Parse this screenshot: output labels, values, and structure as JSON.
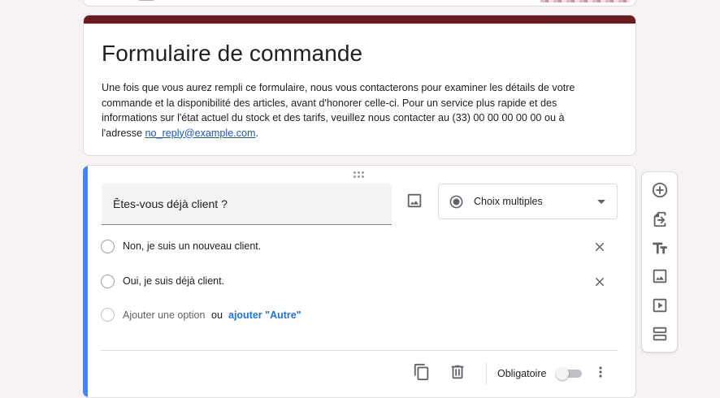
{
  "form": {
    "title": "Formulaire de commande",
    "description_before_link": "Une fois que vous aurez rempli ce formulaire, nous vous contacterons pour examiner les détails de votre commande et la disponibilité des articles, avant d'honorer celle-ci. Pour un service plus rapide et des informations sur l'état actuel du stock et des tarifs, veuillez nous contacter au (33) 00 00 00 00 00 ou à l'adresse ",
    "description_link": "no_reply@example.com",
    "description_after_link": ".",
    "accent_color": "#6b1a1d"
  },
  "question": {
    "title": "Êtes-vous déjà client ?",
    "type_label": "Choix multiples",
    "options": [
      {
        "label": "Non, je suis un nouveau client."
      },
      {
        "label": "Oui, je suis déjà client."
      }
    ],
    "add_option_label": "Ajouter une option",
    "or_label": "ou",
    "add_other_label": "ajouter \"Autre\"",
    "required_label": "Obligatoire",
    "required": false,
    "active_color": "#4285f4"
  },
  "icons": {
    "question_image": "image-icon",
    "type_radio": "radio-checked-icon",
    "remove_option": "close-icon",
    "duplicate": "copy-icon",
    "delete": "trash-icon",
    "more": "more-vert-icon"
  },
  "side_toolbar": [
    {
      "name": "add-question-icon"
    },
    {
      "name": "import-questions-icon"
    },
    {
      "name": "add-title-icon"
    },
    {
      "name": "add-image-icon"
    },
    {
      "name": "add-video-icon"
    },
    {
      "name": "add-section-icon"
    }
  ]
}
